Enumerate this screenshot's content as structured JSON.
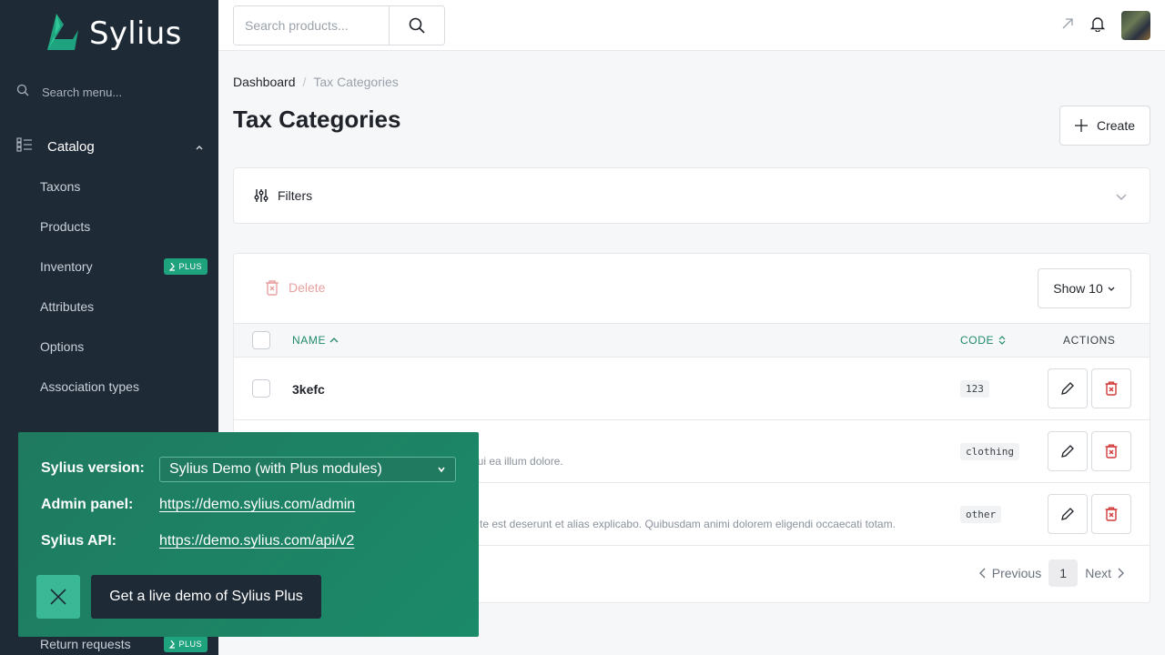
{
  "brand": {
    "name": "Sylius",
    "accent": "#1fa37e"
  },
  "sidebar": {
    "search_placeholder": "Search menu...",
    "section": {
      "label": "Catalog",
      "icon": "catalog-icon"
    },
    "items": [
      {
        "label": "Taxons",
        "badge": ""
      },
      {
        "label": "Products",
        "badge": ""
      },
      {
        "label": "Inventory",
        "badge": "PLUS"
      },
      {
        "label": "Attributes",
        "badge": ""
      },
      {
        "label": "Options",
        "badge": ""
      },
      {
        "label": "Association types",
        "badge": ""
      }
    ],
    "bottom_item": {
      "label": "Return requests",
      "badge": "PLUS"
    }
  },
  "topbar": {
    "search_placeholder": "Search products..."
  },
  "breadcrumb": {
    "home": "Dashboard",
    "current": "Tax Categories"
  },
  "page": {
    "title": "Tax Categories",
    "create_label": "Create"
  },
  "filters": {
    "label": "Filters"
  },
  "table": {
    "delete_label": "Delete",
    "show_label": "Show 10",
    "columns": {
      "name": "NAME",
      "code": "CODE",
      "actions": "ACTIONS"
    },
    "rows": [
      {
        "name": "3kefc",
        "description": "",
        "code": "123"
      },
      {
        "name": "",
        "description": "qui ea illum dolore.",
        "code": "clothing"
      },
      {
        "name": "",
        "description": "te est deserunt et alias explicabo. Quibusdam animi dolorem eligendi occaecati totam.",
        "code": "other"
      }
    ]
  },
  "pagination": {
    "previous": "Previous",
    "page": "1",
    "next": "Next"
  },
  "demo": {
    "version_label": "Sylius version:",
    "version_value": "Sylius Demo (with Plus modules)",
    "admin_label": "Admin panel:",
    "admin_url": "https://demo.sylius.com/admin",
    "api_label": "Sylius API:",
    "api_url": "https://demo.sylius.com/api/v2",
    "cta_label": "Get a live demo of Sylius Plus"
  }
}
